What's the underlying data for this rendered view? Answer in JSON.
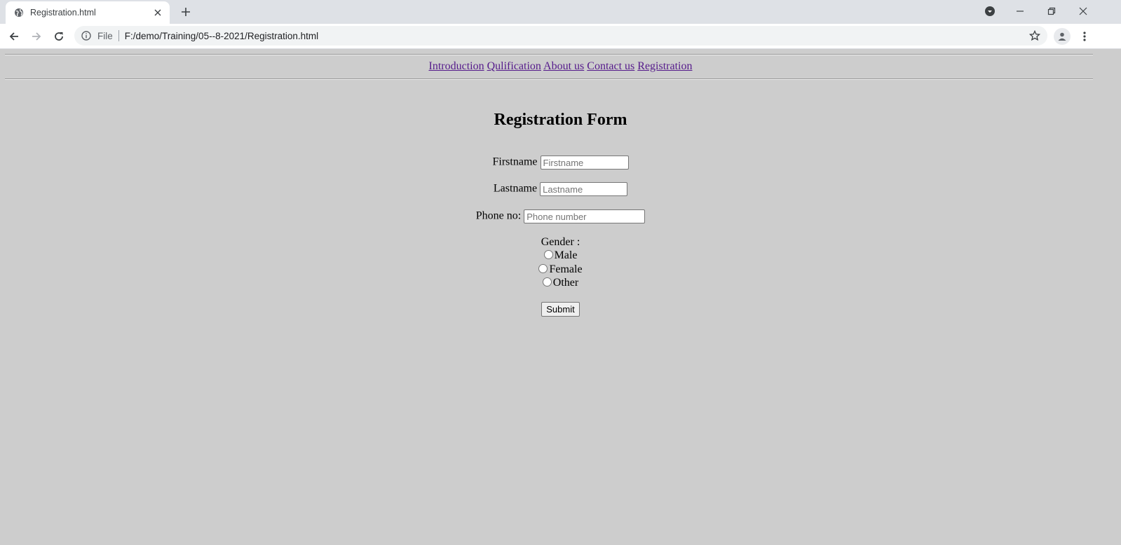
{
  "browser": {
    "tab_title": "Registration.html",
    "omnibox_scheme": "File",
    "url": "F:/demo/Training/05--8-2021/Registration.html"
  },
  "nav": {
    "links": [
      "Introduction",
      "Qulification",
      "About us",
      "Contact us",
      "Registration"
    ]
  },
  "form": {
    "title": "Registration Form",
    "firstname_label": "Firstname",
    "firstname_placeholder": "Firstname",
    "lastname_label": "Lastname",
    "lastname_placeholder": "Lastname",
    "phone_label": "Phone no:",
    "phone_placeholder": "Phone number",
    "gender_label": "Gender :",
    "gender_options": [
      "Male",
      "Female",
      "Other"
    ],
    "submit_label": "Submit"
  },
  "colors": {
    "page_background": "#cdcdcd",
    "link_color": "#551a8b"
  }
}
